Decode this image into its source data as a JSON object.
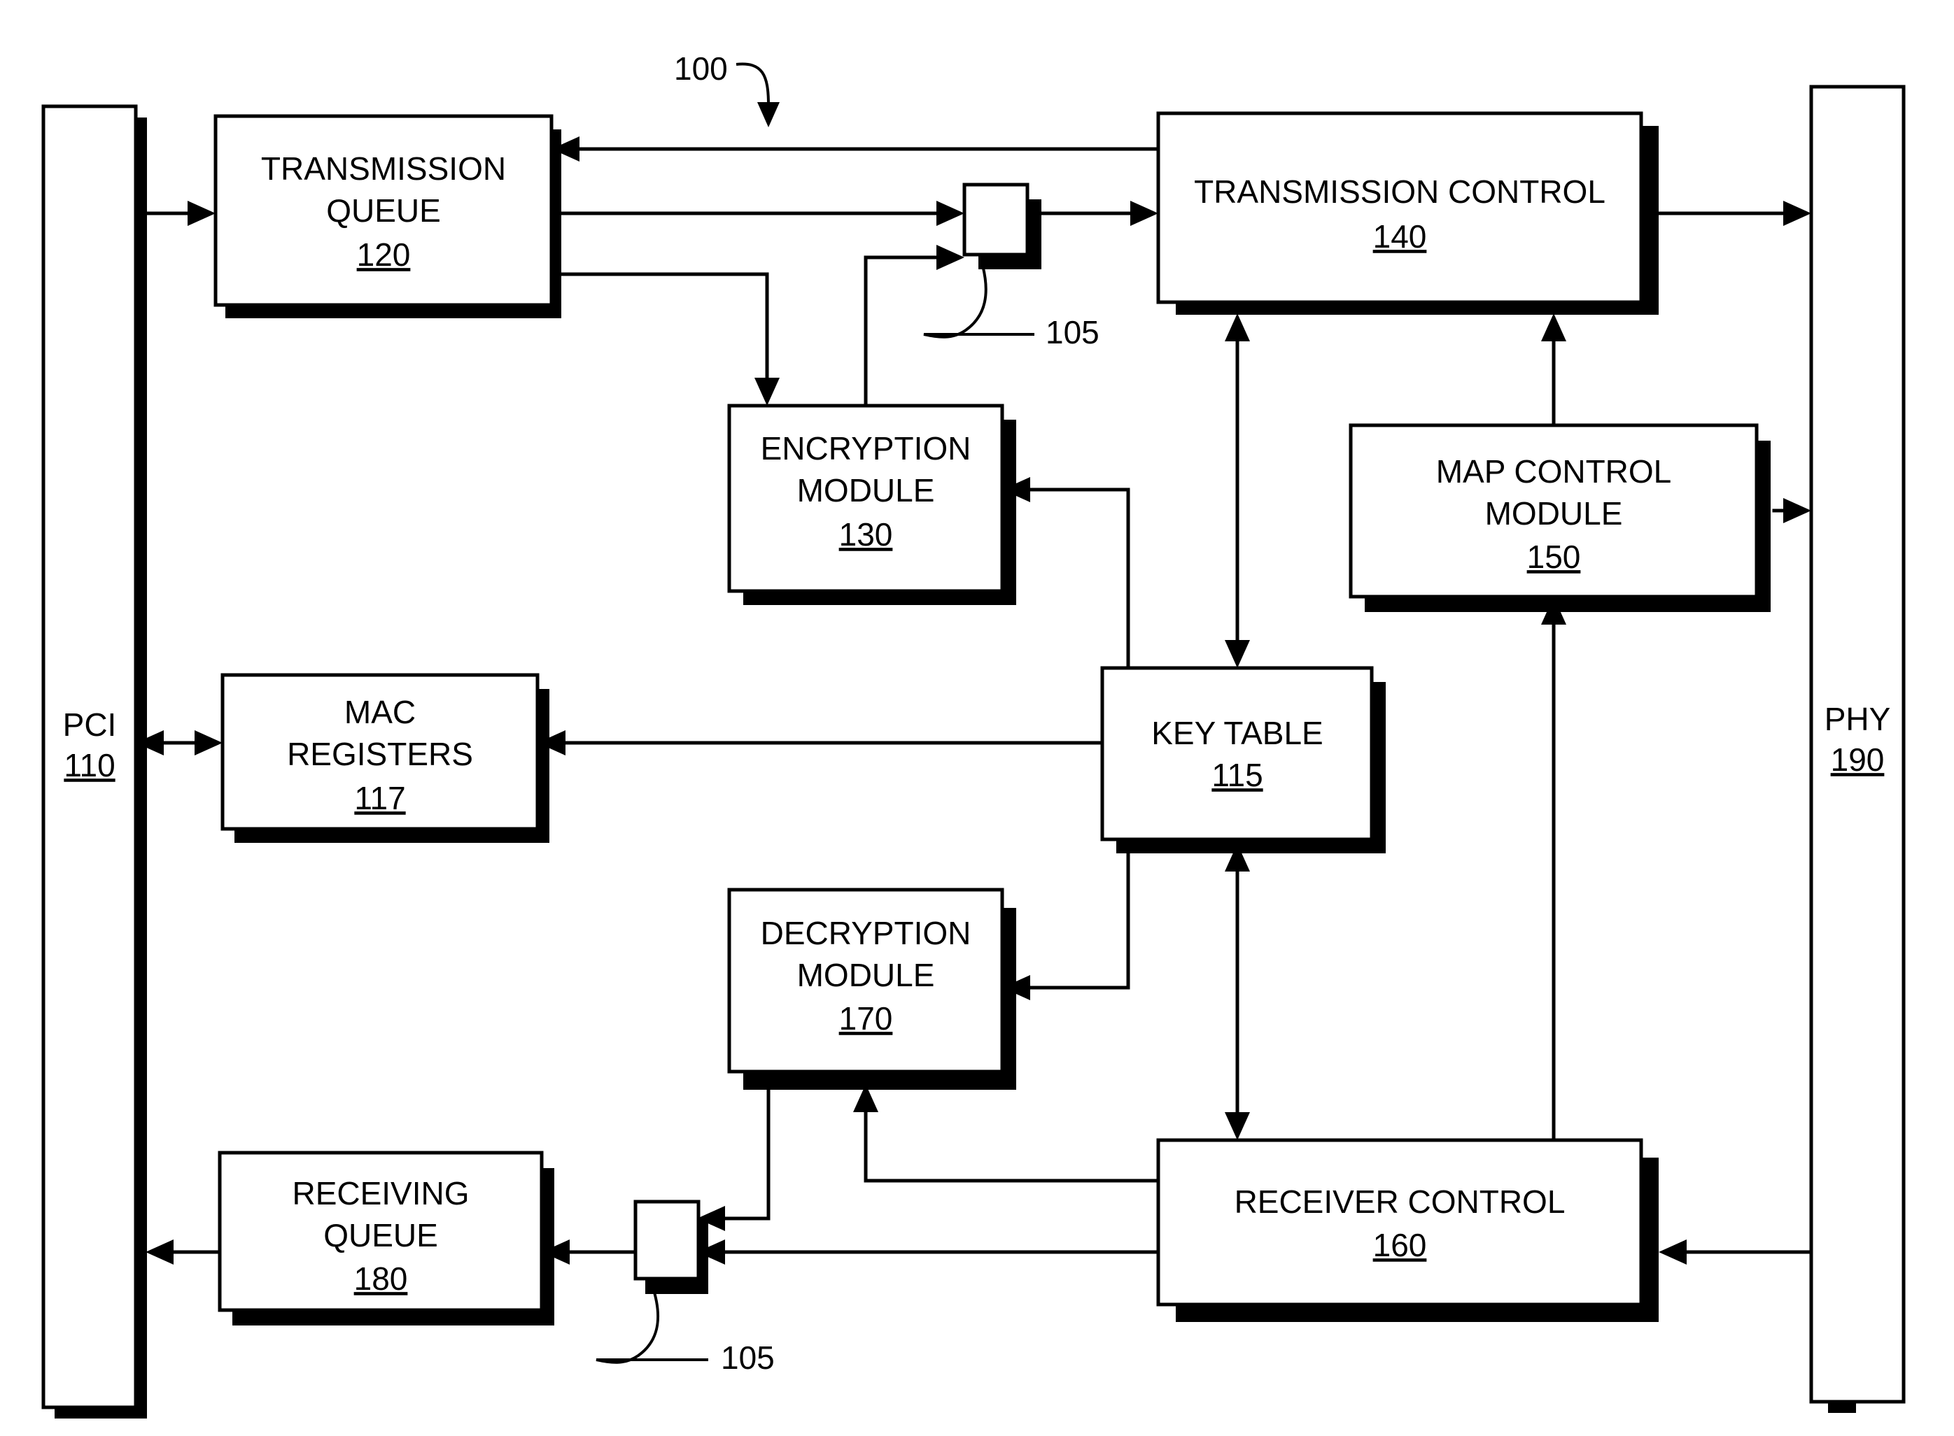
{
  "figure": {
    "figure_ref": "100",
    "callouts": [
      {
        "id": "mux-top",
        "text": "105"
      },
      {
        "id": "mux-bottom",
        "text": "105"
      }
    ]
  },
  "blocks": {
    "pci": {
      "name": "PCI",
      "line1": "PCI",
      "line2": "",
      "ref": "110"
    },
    "phy": {
      "name": "PHY",
      "line1": "PHY",
      "line2": "",
      "ref": "190"
    },
    "tx_queue": {
      "name": "Transmission Queue",
      "line1": "TRANSMISSION",
      "line2": "QUEUE",
      "ref": "120"
    },
    "tx_control": {
      "name": "Transmission Control",
      "line1": "TRANSMISSION CONTROL",
      "line2": "",
      "ref": "140"
    },
    "encryption": {
      "name": "Encryption Module",
      "line1": "ENCRYPTION",
      "line2": "MODULE",
      "ref": "130"
    },
    "map_control": {
      "name": "Map Control Module",
      "line1": "MAP CONTROL",
      "line2": "MODULE",
      "ref": "150"
    },
    "mac_regs": {
      "name": "MAC Registers",
      "line1": "MAC",
      "line2": "REGISTERS",
      "ref": "117"
    },
    "key_table": {
      "name": "Key Table",
      "line1": "KEY TABLE",
      "line2": "",
      "ref": "115"
    },
    "decryption": {
      "name": "Decryption Module",
      "line1": "DECRYPTION",
      "line2": "MODULE",
      "ref": "170"
    },
    "receiver_control": {
      "name": "Receiver Control",
      "line1": "RECEIVER CONTROL",
      "line2": "",
      "ref": "160"
    },
    "rx_queue": {
      "name": "Receiving Queue",
      "line1": "RECEIVING",
      "line2": "QUEUE",
      "ref": "180"
    },
    "mux_top": {
      "name": "Multiplexer (transmit path)",
      "line1": "",
      "line2": "",
      "ref": "105"
    },
    "mux_bottom": {
      "name": "Multiplexer (receive path)",
      "line1": "",
      "line2": "",
      "ref": "105"
    }
  },
  "colors": {
    "stroke": "#000000",
    "fill": "#ffffff",
    "shadow": "#000000"
  }
}
